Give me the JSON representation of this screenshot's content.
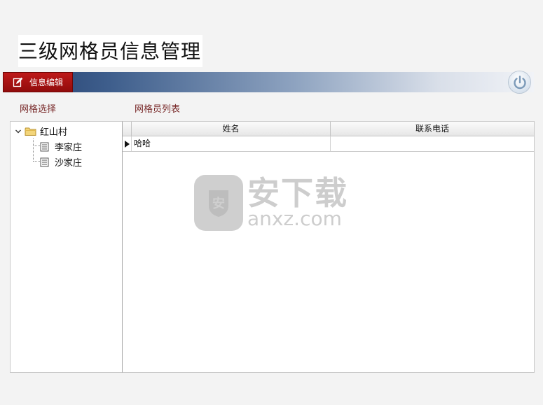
{
  "header": {
    "title": "三级网格员信息管理"
  },
  "toolbar": {
    "edit_label": "信息编辑",
    "colors": {
      "edit_bg": "#a01212",
      "band_start": "#1f3a6b",
      "band_end": "#f1f3f7"
    }
  },
  "sections": {
    "grid_select_label": "网格选择",
    "member_list_label": "网格员列表"
  },
  "tree": {
    "root": {
      "label": "红山村",
      "expanded": true
    },
    "children": [
      {
        "label": "李家庄"
      },
      {
        "label": "沙家庄"
      }
    ]
  },
  "table": {
    "columns": [
      "姓名",
      "联系电话"
    ],
    "rows": [
      {
        "name": "哈哈",
        "phone": ""
      }
    ]
  },
  "watermark": {
    "badge_char": "安",
    "cn_text": "安下载",
    "en_text": "anxz.com"
  }
}
